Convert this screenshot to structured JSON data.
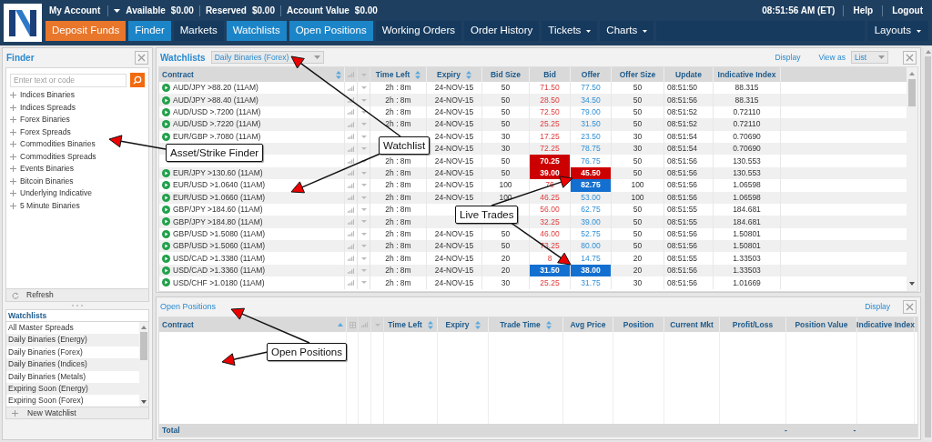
{
  "account_bar": {
    "title": "My Account",
    "items": [
      {
        "label": "Available",
        "value": "$0.00"
      },
      {
        "label": "Reserved",
        "value": "$0.00"
      },
      {
        "label": "Account Value",
        "value": "$0.00"
      }
    ],
    "time": "08:51:56 AM (ET)",
    "links": [
      "Help",
      "Logout"
    ]
  },
  "nav": [
    {
      "label": "Deposit Funds",
      "kind": "deposit",
      "selected": false
    },
    {
      "label": "Finder",
      "kind": "tab",
      "selected": true
    },
    {
      "label": "Markets",
      "kind": "tab",
      "selected": false
    },
    {
      "label": "Watchlists",
      "kind": "tab",
      "selected": true
    },
    {
      "label": "Open Positions",
      "kind": "tab",
      "selected": true
    },
    {
      "label": "Working Orders",
      "kind": "tab",
      "selected": false
    },
    {
      "label": "Order History",
      "kind": "tab",
      "selected": false
    },
    {
      "label": "Tickets",
      "kind": "menu",
      "selected": false
    },
    {
      "label": "Charts",
      "kind": "menu",
      "selected": false
    }
  ],
  "layouts": "Layouts",
  "finder": {
    "title": "Finder",
    "search": {
      "placeholder": "Enter text or code"
    },
    "items": [
      {
        "label": "Indices Binaries",
        "expanded": false
      },
      {
        "label": "Indices Spreads",
        "expanded": false
      },
      {
        "label": "Forex Binaries",
        "expanded": false
      },
      {
        "label": "Forex Spreads",
        "expanded": false
      },
      {
        "label": "Commodities Binaries",
        "expanded": false
      },
      {
        "label": "Commodities Spreads",
        "expanded": false
      },
      {
        "label": "Events Binaries",
        "expanded": false
      },
      {
        "label": "Bitcoin Binaries",
        "expanded": false
      },
      {
        "label": "Underlying Indicative",
        "expanded": false
      },
      {
        "label": "5 Minute Binaries",
        "expanded": false
      }
    ],
    "refresh": "Refresh"
  },
  "watchlists_panel": {
    "title": "Watchlists",
    "items": [
      "All Master Spreads",
      "Daily Binaries (Energy)",
      "Daily Binaries (Forex)",
      "Daily Binaries (Indices)",
      "Daily Binaries (Metals)",
      "Expiring Soon (Energy)",
      "Expiring Soon (Forex)"
    ],
    "new": "New Watchlist"
  },
  "watchlist": {
    "title": "Watchlists",
    "dropdown": "Daily Binaries (Forex)",
    "display": "Display",
    "view_as": {
      "label": "View as",
      "value": "List"
    },
    "columns": [
      {
        "label": "Contract",
        "sortable": true
      },
      {
        "label": "Time Left",
        "sortable": true
      },
      {
        "label": "Expiry",
        "sortable": true
      },
      {
        "label": "Bid Size",
        "sortable": false
      },
      {
        "label": "Bid",
        "sortable": false
      },
      {
        "label": "Offer",
        "sortable": false
      },
      {
        "label": "Offer Size",
        "sortable": false
      },
      {
        "label": "Update",
        "sortable": false
      },
      {
        "label": "Indicative Index",
        "sortable": false
      }
    ],
    "rows": [
      {
        "contract": "AUD/JPY >88.20 (11AM)",
        "time_left": "2h : 8m",
        "expiry": "24-NOV-15",
        "bid_size": "50",
        "bid": "71.50",
        "offer": "77.50",
        "offer_size": "50",
        "update": "08:51:50",
        "index": "88.315"
      },
      {
        "contract": "AUD/JPY >88.40 (11AM)",
        "time_left": "2h : 8m",
        "expiry": "24-NOV-15",
        "bid_size": "50",
        "bid": "28.50",
        "offer": "34.50",
        "offer_size": "50",
        "update": "08:51:56",
        "index": "88.315"
      },
      {
        "contract": "AUD/USD >.7200 (11AM)",
        "time_left": "2h : 8m",
        "expiry": "24-NOV-15",
        "bid_size": "50",
        "bid": "72.50",
        "offer": "79.00",
        "offer_size": "50",
        "update": "08:51:52",
        "index": "0.72110"
      },
      {
        "contract": "AUD/USD >.7220 (11AM)",
        "time_left": "2h : 8m",
        "expiry": "24-NOV-15",
        "bid_size": "50",
        "bid": "25.25",
        "offer": "31.50",
        "offer_size": "50",
        "update": "08:51:52",
        "index": "0.72110"
      },
      {
        "contract": "EUR/GBP >.7080 (11AM)",
        "expiry": "24-NOV-15",
        "bid_size": "30",
        "bid": "17.25",
        "offer": "23.50",
        "offer_size": "30",
        "update": "08:51:54",
        "index": "0.70690"
      },
      {
        "expiry": "24-NOV-15",
        "bid_size": "30",
        "bid": "72.25",
        "offer": "78.75",
        "offer_size": "30",
        "update": "08:51:54",
        "index": "0.70690"
      },
      {
        "time_left": "2h : 8m",
        "expiry": "24-NOV-15",
        "bid_size": "50",
        "bid": "70.25",
        "offer": "76.75",
        "offer_size": "50",
        "update": "08:51:56",
        "index": "130.553",
        "bid_highlight": {
          "color": "#cc0000"
        }
      },
      {
        "contract": "EUR/JPY >130.60 (11AM)",
        "time_left": "2h : 8m",
        "expiry": "24-NOV-15",
        "bid_size": "50",
        "bid": "39.00",
        "offer": "45.50",
        "offer_size": "50",
        "update": "08:51:56",
        "index": "130.553",
        "bid_highlight": {
          "color": "#cc0000"
        },
        "offer_highlight": {
          "color": "#cc0000"
        }
      },
      {
        "contract": "EUR/USD >1.0640 (11AM)",
        "time_left": "2h : 8m",
        "expiry": "24-NOV-15",
        "bid_size": "100",
        "bid": "76",
        "offer": "82.75",
        "offer_size": "100",
        "update": "08:51:56",
        "index": "1.06598",
        "offer_highlight": {
          "color": "#1470d0"
        }
      },
      {
        "contract": "EUR/USD >1.0660 (11AM)",
        "time_left": "2h : 8m",
        "expiry": "24-NOV-15",
        "bid_size": "100",
        "bid": "46.25",
        "offer": "53.00",
        "offer_size": "100",
        "update": "08:51:56",
        "index": "1.06598"
      },
      {
        "contract": "GBP/JPY >184.60 (11AM)",
        "time_left": "2h : 8m",
        "bid": "56.00",
        "offer": "62.75",
        "offer_size": "50",
        "update": "08:51:55",
        "index": "184.681"
      },
      {
        "contract": "GBP/JPY >184.80 (11AM)",
        "time_left": "2h : 8m",
        "bid": "32.25",
        "offer": "39.00",
        "offer_size": "50",
        "update": "08:51:55",
        "index": "184.681"
      },
      {
        "contract": "GBP/USD >1.5080 (11AM)",
        "time_left": "2h : 8m",
        "expiry": "24-NOV-15",
        "bid_size": "50",
        "bid": "46.00",
        "offer": "52.75",
        "offer_size": "50",
        "update": "08:51:56",
        "index": "1.50801"
      },
      {
        "contract": "GBP/USD >1.5060 (11AM)",
        "time_left": "2h : 8m",
        "expiry": "24-NOV-15",
        "bid_size": "50",
        "bid": "73.25",
        "offer": "80.00",
        "offer_size": "50",
        "update": "08:51:56",
        "index": "1.50801"
      },
      {
        "contract": "USD/CAD >1.3380 (11AM)",
        "time_left": "2h : 8m",
        "expiry": "24-NOV-15",
        "bid_size": "20",
        "bid": "8",
        "offer": "14.75",
        "offer_size": "20",
        "update": "08:51:55",
        "index": "1.33503"
      },
      {
        "contract": "USD/CAD >1.3360 (11AM)",
        "time_left": "2h : 8m",
        "expiry": "24-NOV-15",
        "bid_size": "20",
        "bid": "31.50",
        "offer": "38.00",
        "offer_size": "20",
        "update": "08:51:56",
        "index": "1.33503",
        "bid_highlight": {
          "color": "#1470d0"
        },
        "offer_highlight": {
          "color": "#1470d0"
        }
      },
      {
        "contract": "USD/CHF >1.0180 (11AM)",
        "time_left": "2h : 8m",
        "expiry": "24-NOV-15",
        "bid_size": "30",
        "bid": "25.25",
        "offer": "31.75",
        "offer_size": "30",
        "update": "08:51:56",
        "index": "1.01669"
      }
    ]
  },
  "open_positions": {
    "title": "Open Positions",
    "display": "Display",
    "columns": [
      {
        "label": "Contract",
        "sortable": true
      },
      {
        "label": "Time Left",
        "sortable": true
      },
      {
        "label": "Expiry",
        "sortable": true
      },
      {
        "label": "Trade Time",
        "sortable": true
      },
      {
        "label": "Avg Price",
        "sortable": false
      },
      {
        "label": "Position",
        "sortable": false
      },
      {
        "label": "Current Mkt",
        "sortable": false
      },
      {
        "label": "Profit/Loss",
        "sortable": false
      },
      {
        "label": "Position Value",
        "sortable": false
      },
      {
        "label": "Indicative Index",
        "sortable": false
      }
    ],
    "total": {
      "label": "Total",
      "profit_loss": "-",
      "position_value": "-"
    }
  },
  "annotations": [
    {
      "text": "Asset/Strike Finder"
    },
    {
      "text": "Watchlist"
    },
    {
      "text": "Live Trades"
    },
    {
      "text": "Open Positions"
    }
  ]
}
